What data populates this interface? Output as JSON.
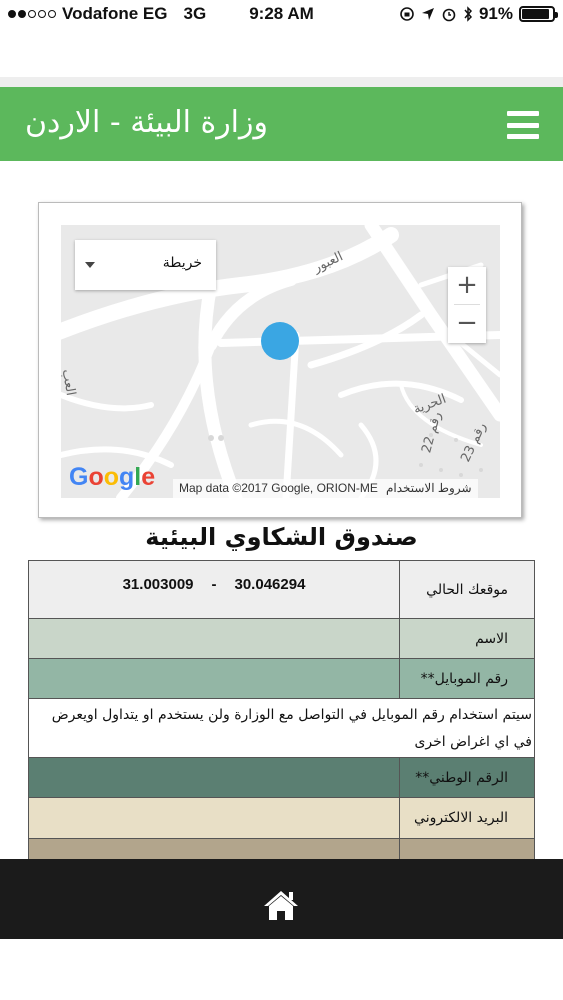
{
  "status_bar": {
    "carrier": "Vodafone EG",
    "network": "3G",
    "time": "9:28 AM",
    "battery": "91%",
    "battery_level": 0.91,
    "signal_bars_filled": 2
  },
  "header": {
    "title": "وزارة البيئة - الاردن",
    "menu_icon": "hamburger-icon",
    "background_color": "#5cb85c"
  },
  "map": {
    "map_type": "خريطة",
    "zoom_in": "+",
    "zoom_out": "−",
    "google": [
      "G",
      "o",
      "o",
      "g",
      "l",
      "e"
    ],
    "google_colors": [
      "#4285F4",
      "#EA4335",
      "#FBBC05",
      "#4285F4",
      "#34A853",
      "#EA4335"
    ],
    "attribution": "Map data ©2017 Google, ORION-ME",
    "terms": "شروط الاستخدام",
    "road_labels": {
      "a": "العبور",
      "b": "الحرية",
      "c": "رقم 22",
      "d": "رقم 23",
      "e": "العب"
    },
    "location_color": "#3aa6e3"
  },
  "page_title": "صندوق الشكاوي البيئية",
  "form": {
    "location_label": "موقعك الحالي",
    "latitude": "30.046294",
    "separator": "-",
    "longitude": "31.003009",
    "name_label": "الاسم",
    "mobile_label": "رقم الموبايل**",
    "mobile_note": "سيتم استخدام رقم الموبايل في التواصل مع الوزارة ولن يستخدم او يتداول اويعرض في اي اغراض اخرى",
    "national_id_label": "الرقم الوطني**",
    "email_label": "البريد الالكتروني",
    "row_colors": [
      "#eeeeee",
      "#c9d6c9",
      "#93b6a5",
      "#ffffff",
      "#5b7f72",
      "#e8dfc6",
      "#b2a58c"
    ]
  },
  "bottom_bar": {
    "home_icon": "home-icon"
  }
}
